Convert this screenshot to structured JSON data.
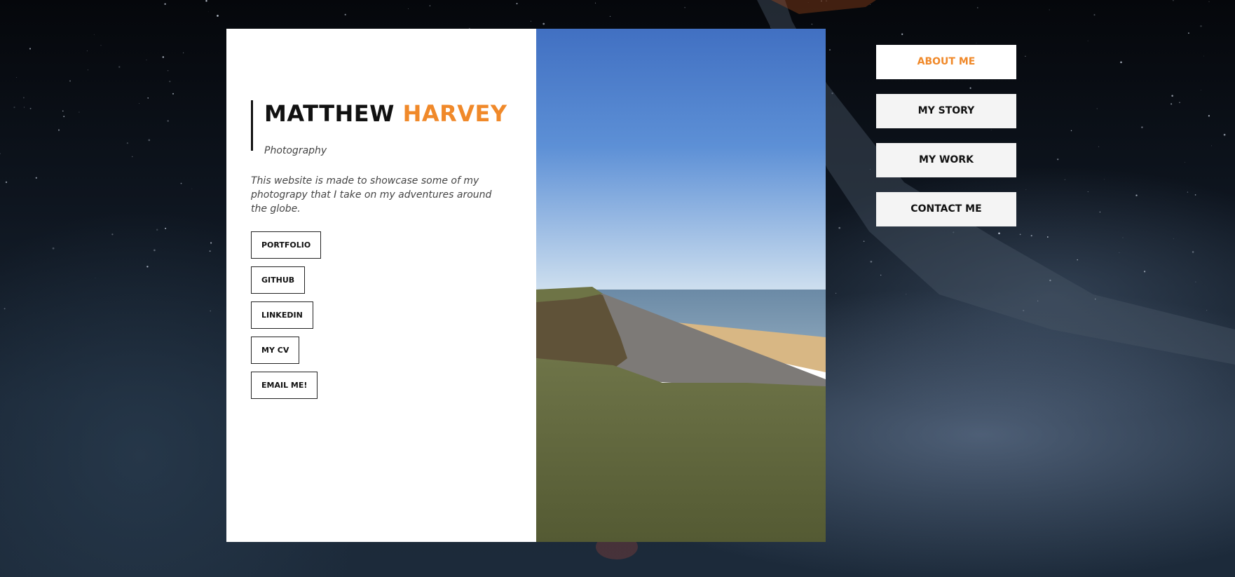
{
  "profile": {
    "first_name": "MATTHEW",
    "last_name": "HARVEY",
    "subtitle": "Photography",
    "description": "This website is made to showcase some of my photograpy that I take on my adventures around the globe."
  },
  "links": [
    {
      "label": "PORTFOLIO"
    },
    {
      "label": "GITHUB"
    },
    {
      "label": "LINKEDIN"
    },
    {
      "label": "MY CV"
    },
    {
      "label": "EMAIL ME!"
    }
  ],
  "nav": [
    {
      "label": "ABOUT ME",
      "active": true
    },
    {
      "label": "MY STORY",
      "active": false
    },
    {
      "label": "MY WORK",
      "active": false
    },
    {
      "label": "CONTACT ME",
      "active": false
    }
  ],
  "colors": {
    "accent": "#f0892a",
    "card_bg": "#ffffff",
    "nav_bg": "#f4f4f4"
  }
}
